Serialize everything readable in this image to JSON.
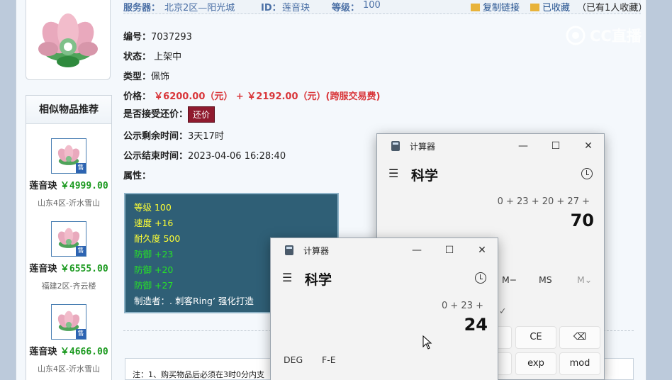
{
  "infobar": {
    "server_label": "服务器：",
    "server_value": "北京2区—阳光城",
    "id_label": "ID：",
    "id_value": "莲音玦",
    "level_label": "等级：",
    "level_value": "100",
    "copy_link": "复制链接",
    "favorited": "已收藏",
    "fav_count": "（已有1人收藏）"
  },
  "watermark": "CC直播",
  "item": {
    "number_label": "编号：",
    "number_value": "7037293",
    "status_label": "状态：",
    "status_value": "上架中",
    "type_label": "类型：",
    "type_value": "佩饰",
    "price_label": "价格：",
    "price_value": "￥6200.00（元） + ￥2192.00（元）(跨服交易费)",
    "bargain_label": "是否接受还价：",
    "bargain_button": "还价",
    "remain_label": "公示剩余时间：",
    "remain_value": "3天17时",
    "end_label": "公示结束时间：",
    "end_value": "2023-04-06 16:28:40",
    "attr_label": "属性："
  },
  "attributes": [
    {
      "text": "等级 100",
      "color": "#ffff33"
    },
    {
      "text": "速度 +16",
      "color": "#ffff33"
    },
    {
      "text": "耐久度 500",
      "color": "#ffff33"
    },
    {
      "text": "防御 +23",
      "color": "#27e027"
    },
    {
      "text": "防御 +20",
      "color": "#27e027"
    },
    {
      "text": "防御 +27",
      "color": "#27e027"
    },
    {
      "text": "制造者：. 刺客Ring’ 强化打造",
      "color": "#ffffff"
    }
  ],
  "similar": {
    "title": "相似物品推荐",
    "sell_badge": "售",
    "items": [
      {
        "name": "莲音玦",
        "price": "￥4999.00",
        "server": "山东4区-沂水雪山"
      },
      {
        "name": "莲音玦",
        "price": "￥6555.00",
        "server": "福建2区-齐云楼"
      },
      {
        "name": "莲音玦",
        "price": "￥4666.00",
        "server": "山东4区-沂水雪山"
      }
    ]
  },
  "note": "注：1、购买物品后必须在3时0分内支",
  "calc_back": {
    "title": "计算器",
    "mode": "科学",
    "expression": "0 + 23 + 20 + 27 +",
    "result": "70",
    "mem_minus": "M−",
    "mem_store": "MS",
    "mem_menu": "M⌄",
    "key_ce": "CE",
    "key_back": "⌫",
    "key_exp": "exp",
    "key_mod": "mod"
  },
  "calc_front": {
    "title": "计算器",
    "mode": "科学",
    "expression": "0 + 23 +",
    "result": "24",
    "deg": "DEG",
    "fe": "F-E"
  }
}
